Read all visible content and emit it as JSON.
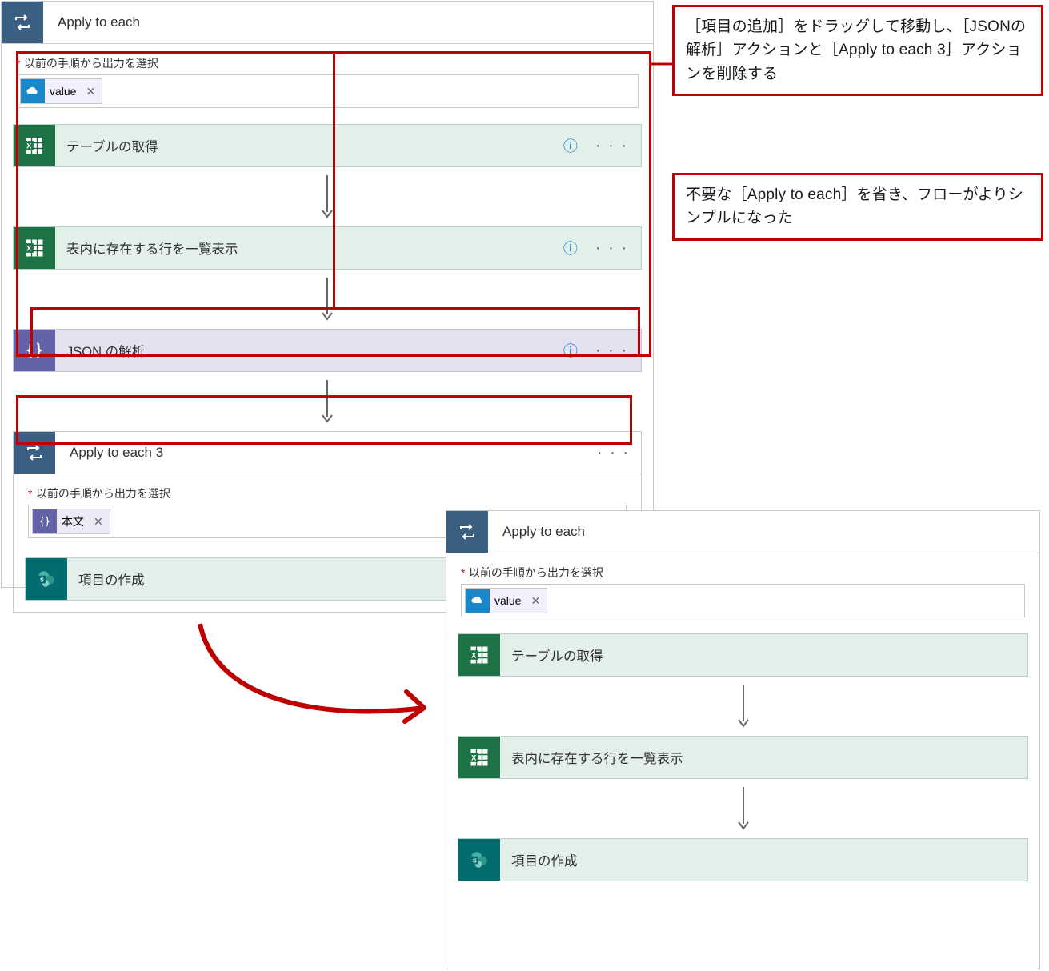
{
  "panel1": {
    "header_title": "Apply to each",
    "output_label": "以前の手順から出力を選択",
    "token_value": "value",
    "action_get_tables": "テーブルの取得",
    "action_list_rows": "表内に存在する行を一覧表示",
    "action_parse_json": "JSON の解析",
    "sub_header_title": "Apply to each 3",
    "sub_output_label": "以前の手順から出力を選択",
    "sub_token_value": "本文",
    "action_create_item": "項目の作成"
  },
  "panel2": {
    "header_title": "Apply to each",
    "output_label": "以前の手順から出力を選択",
    "token_value": "value",
    "action_get_tables": "テーブルの取得",
    "action_list_rows": "表内に存在する行を一覧表示",
    "action_create_item": "項目の作成"
  },
  "callout1": "［項目の追加］をドラッグして移動し、［JSONの解析］アクションと［Apply to each 3］アクションを削除する",
  "callout2": "不要な［Apply to each］を省き、フローがよりシンプルになった",
  "glyphs": {
    "help": "?",
    "more": "· · ·",
    "close": "✕",
    "asterisk": "*"
  },
  "colors": {
    "scope_blue": "#3a5f82",
    "excel_green": "#1e7346",
    "json_purple": "#6264a7",
    "sharepoint_teal": "#036c70",
    "onedrive_blue": "#1a87c9"
  }
}
